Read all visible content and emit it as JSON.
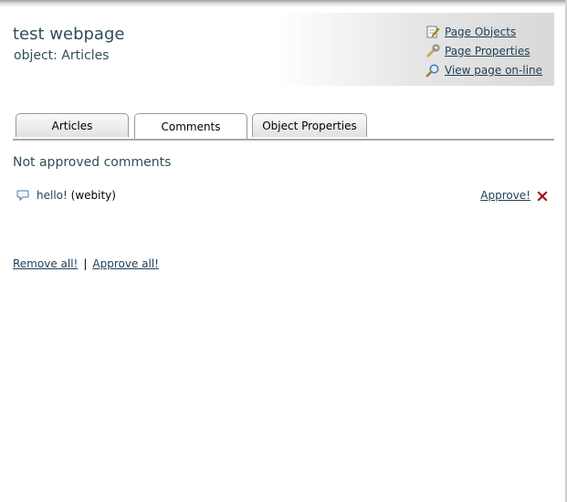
{
  "header": {
    "site_title": "test webpage",
    "object_line": "object: Articles",
    "links": [
      {
        "label": "Page Objects",
        "icon": "edit-icon"
      },
      {
        "label": "Page Properties",
        "icon": "wrench-icon"
      },
      {
        "label": "View page on-line",
        "icon": "magnifier-icon"
      }
    ]
  },
  "tabs": [
    {
      "label": "Articles",
      "active": false
    },
    {
      "label": "Comments",
      "active": true
    },
    {
      "label": "Object Properties",
      "active": false
    }
  ],
  "section_title": "Not approved comments",
  "comments": [
    {
      "text": "hello!",
      "author": "(webity)",
      "approve_label": "Approve!",
      "icon": "comment-bubble-icon",
      "delete_icon": "delete-x-icon"
    }
  ],
  "bottom": {
    "remove_all": "Remove all!",
    "separator": "|",
    "approve_all": "Approve all!"
  },
  "colors": {
    "heading": "#2f4f5a",
    "link": "#1f3e55",
    "delete": "#cc1111"
  }
}
